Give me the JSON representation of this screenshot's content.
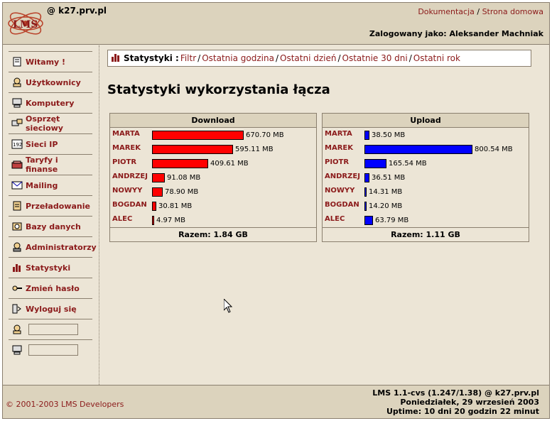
{
  "header": {
    "host": "@ k27.prv.pl",
    "links": [
      "Dokumentacja",
      "Strona domowa"
    ],
    "logged_in": "Zalogowany jako: Aleksander Machniak"
  },
  "sidebar": {
    "items": [
      {
        "label": "Witamy !",
        "icon": "page-icon"
      },
      {
        "label": "Użytkownicy",
        "icon": "users-icon"
      },
      {
        "label": "Komputery",
        "icon": "computer-icon"
      },
      {
        "label": "Osprzęt sieciowy",
        "icon": "network-icon"
      },
      {
        "label": "Sieci IP",
        "icon": "ip-icon"
      },
      {
        "label": "Taryfy i finanse",
        "icon": "finance-icon"
      },
      {
        "label": "Mailing",
        "icon": "mail-icon"
      },
      {
        "label": "Przeładowanie",
        "icon": "reload-icon"
      },
      {
        "label": "Bazy danych",
        "icon": "database-icon"
      },
      {
        "label": "Administratorzy",
        "icon": "admin-icon"
      },
      {
        "label": "Statystyki",
        "icon": "stats-icon"
      },
      {
        "label": "Zmień hasło",
        "icon": "key-icon"
      },
      {
        "label": "Wyloguj się",
        "icon": "logout-icon"
      }
    ],
    "user_search_value": "",
    "computer_search_value": ""
  },
  "breadcrumb": {
    "title": "Statystyki :",
    "links": [
      "Filtr",
      "Ostatnia godzina",
      "Ostatni dzień",
      "Ostatnie 30 dni",
      "Ostatni rok"
    ]
  },
  "main": {
    "title": "Statystyki wykorzystania łącza"
  },
  "download": {
    "header": "Download",
    "total": "Razem: 1.84 GB",
    "color": "#ff0000",
    "rows": [
      {
        "name": "MARTA",
        "mb": 670.7,
        "label": "670.70 MB"
      },
      {
        "name": "MAREK",
        "mb": 595.11,
        "label": "595.11 MB"
      },
      {
        "name": "PIOTR",
        "mb": 409.61,
        "label": "409.61 MB"
      },
      {
        "name": "ANDRZEJ",
        "mb": 91.08,
        "label": "91.08 MB"
      },
      {
        "name": "NOWYY",
        "mb": 78.9,
        "label": "78.90 MB"
      },
      {
        "name": "BOGDAN",
        "mb": 30.81,
        "label": "30.81 MB"
      },
      {
        "name": "ALEC",
        "mb": 4.97,
        "label": "4.97 MB"
      }
    ]
  },
  "upload": {
    "header": "Upload",
    "total": "Razem: 1.11 GB",
    "color": "#0000ff",
    "rows": [
      {
        "name": "MARTA",
        "mb": 38.5,
        "label": "38.50 MB"
      },
      {
        "name": "MAREK",
        "mb": 800.54,
        "label": "800.54 MB"
      },
      {
        "name": "PIOTR",
        "mb": 165.54,
        "label": "165.54 MB"
      },
      {
        "name": "ANDRZEJ",
        "mb": 36.51,
        "label": "36.51 MB"
      },
      {
        "name": "NOWYY",
        "mb": 14.31,
        "label": "14.31 MB"
      },
      {
        "name": "BOGDAN",
        "mb": 14.2,
        "label": "14.20 MB"
      },
      {
        "name": "ALEC",
        "mb": 63.79,
        "label": "63.79 MB"
      }
    ]
  },
  "footer": {
    "copyright": "© 2001-2003 LMS Developers",
    "version": "LMS 1.1-cvs (1.247/1.38) @ k27.prv.pl",
    "date": "Poniedziałek, 29 wrzesień 2003",
    "uptime": "Uptime: 10 dni 20 godzin 22 minut"
  }
}
